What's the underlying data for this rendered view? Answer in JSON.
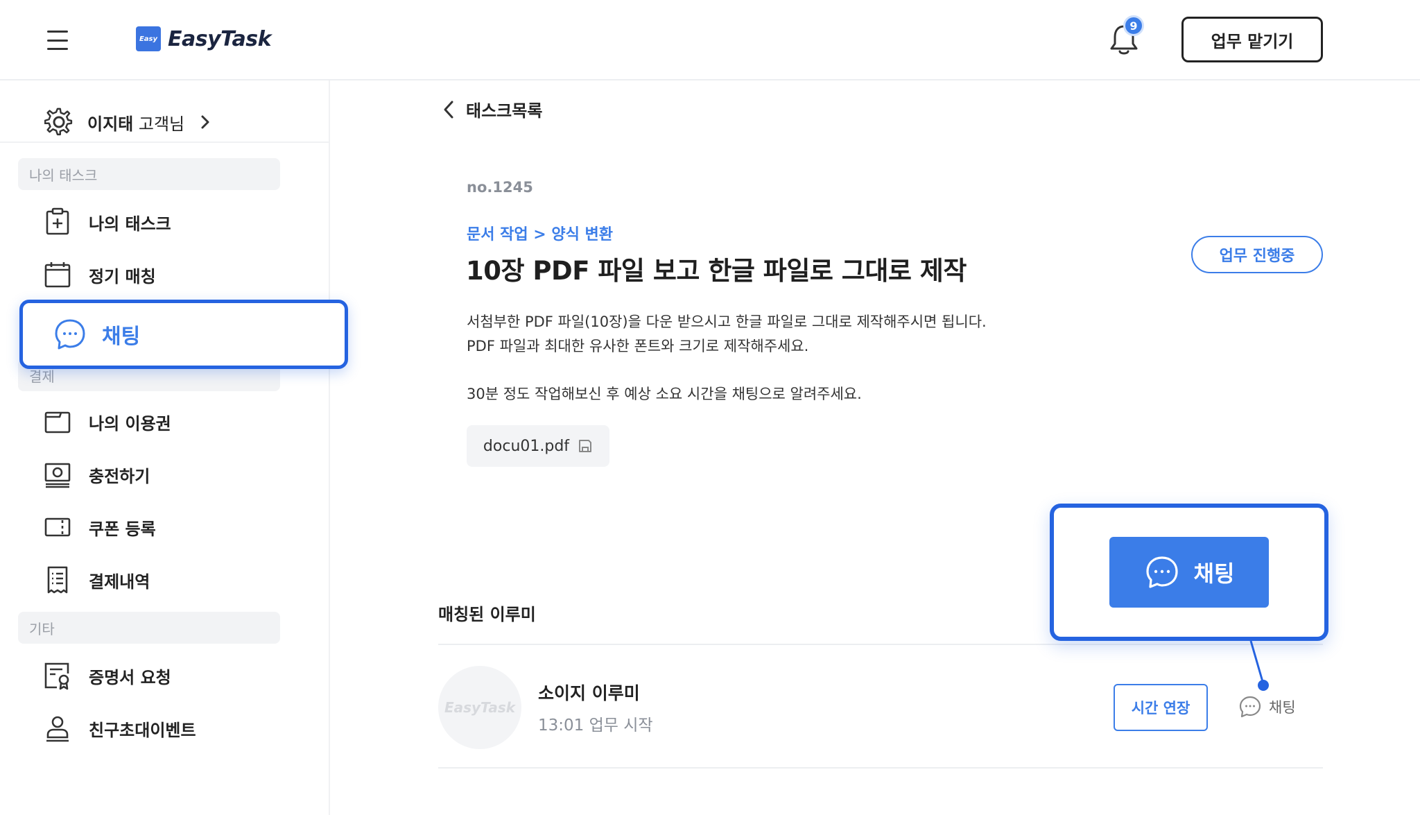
{
  "header": {
    "logo_mark": "Easy",
    "logo_text": "EasyTask",
    "notification_count": "9",
    "request_button": "업무 맡기기"
  },
  "sidebar": {
    "user": {
      "name": "이지태",
      "suffix": "고객님"
    },
    "sections": [
      {
        "label": "나의 태스크"
      },
      {
        "label": "결제"
      },
      {
        "label": "기타"
      }
    ],
    "items": [
      {
        "label": "나의 태스크"
      },
      {
        "label": "정기 매칭"
      },
      {
        "label": "채팅"
      },
      {
        "label": "나의 이용권"
      },
      {
        "label": "충전하기"
      },
      {
        "label": "쿠폰 등록"
      },
      {
        "label": "결제내역"
      },
      {
        "label": "증명서 요청"
      },
      {
        "label": "친구초대이벤트"
      }
    ]
  },
  "main": {
    "back_label": "태스크목록",
    "task_no": "no.1245",
    "breadcrumb": "문서 작업 > 양식 변환",
    "title": "10장 PDF 파일 보고 한글 파일로 그대로 제작",
    "status": "업무 진행중",
    "description": [
      "서첨부한 PDF 파일(10장)을 다운 받으시고 한글 파일로 그대로 제작해주시면 됩니다.",
      "PDF 파일과 최대한 유사한 폰트와 크기로 제작해주세요.",
      "30분 정도 작업해보신 후 예상 소요 시간을 채팅으로 알려주세요."
    ],
    "file_name": "docu01.pdf",
    "matched_title": "매칭된 이루미",
    "iru": {
      "avatar_text": "EasyTask",
      "name": "소이지 이루미",
      "status": "13:01 업무 시작",
      "extend_button": "시간 연장",
      "chat_button": "채팅"
    },
    "callout_chat_button": "채팅"
  },
  "colors": {
    "accent": "#3b7de8",
    "highlight_border": "#2563e0"
  }
}
